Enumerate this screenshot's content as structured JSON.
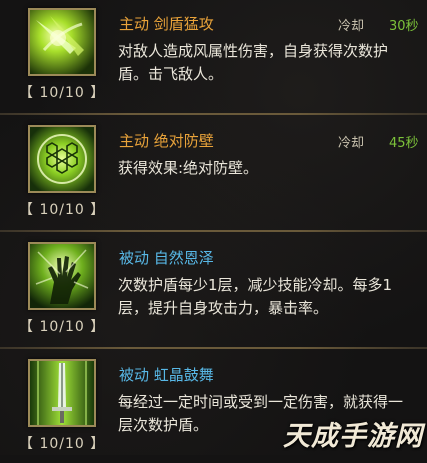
{
  "skills": [
    {
      "type_label": "主动",
      "name": "剑盾猛攻",
      "kind": "active",
      "cooldown_label": "冷却",
      "cooldown_value": "30秒",
      "description": "对敌人造成风属性伤害，自身获得次数护盾。击飞敌人。",
      "level": "【 10/10 】",
      "icon": "sword-shield-strike-icon"
    },
    {
      "type_label": "主动",
      "name": "绝对防壁",
      "kind": "active",
      "cooldown_label": "冷却",
      "cooldown_value": "45秒",
      "description": "获得效果:绝对防壁。",
      "level": "【 10/10 】",
      "icon": "hex-barrier-icon"
    },
    {
      "type_label": "被动",
      "name": "自然恩泽",
      "kind": "passive",
      "cooldown_label": "",
      "cooldown_value": "",
      "description": "次数护盾每少1层，减少技能冷却。每多1层，提升自身攻击力，暴击率。",
      "level": "【 10/10 】",
      "icon": "nature-hand-icon"
    },
    {
      "type_label": "被动",
      "name": "虹晶鼓舞",
      "kind": "passive",
      "cooldown_label": "",
      "cooldown_value": "",
      "description": "每经过一定时间或受到一定伤害，就获得一层次数护盾。",
      "level": "【 10/10 】",
      "icon": "crystal-sword-icon"
    }
  ],
  "watermark": "天成手游网",
  "colors": {
    "active_title": "#e9a33a",
    "passive_title": "#58b8e6",
    "cooldown_value": "#7cc23a",
    "icon_border": "#9c8a58"
  }
}
